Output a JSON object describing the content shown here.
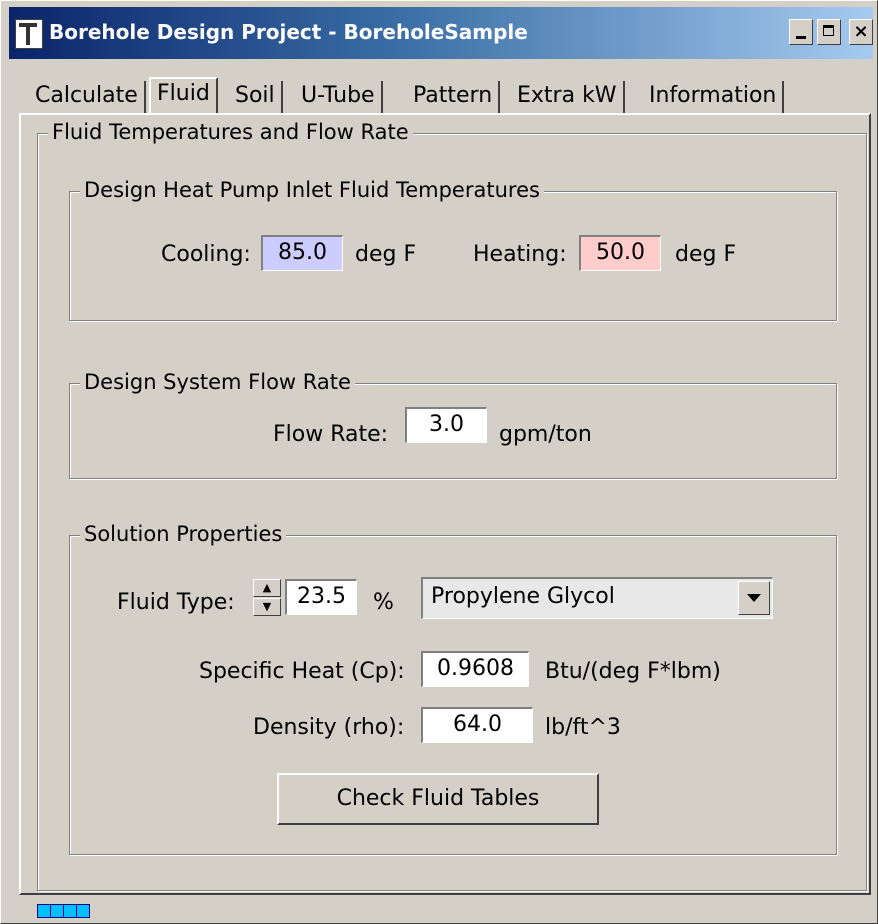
{
  "window": {
    "title": "Borehole Design Project - BoreholeSample"
  },
  "titlebar_buttons": {
    "minimize": "_",
    "maximize": "□",
    "close": "×"
  },
  "tabs": [
    {
      "label": "Calculate"
    },
    {
      "label": "Fluid",
      "active": true
    },
    {
      "label": "Soil"
    },
    {
      "label": "U-Tube"
    },
    {
      "label": "Pattern"
    },
    {
      "label": "Extra kW"
    },
    {
      "label": "Information"
    }
  ],
  "panel": {
    "title": "Fluid Temperatures and Flow Rate"
  },
  "temperatures": {
    "title": "Design Heat Pump Inlet Fluid Temperatures",
    "cooling_label": "Cooling:",
    "cooling_value": "85.0",
    "cooling_unit": "deg F",
    "heating_label": "Heating:",
    "heating_value": "50.0",
    "heating_unit": "deg F",
    "cooling_color": "#ccccff",
    "heating_color": "#ffcccc"
  },
  "flow": {
    "title": "Design System Flow Rate",
    "label": "Flow Rate:",
    "value": "3.0",
    "unit": "gpm/ton"
  },
  "solution": {
    "title": "Solution Properties",
    "fluid_type_label": "Fluid Type:",
    "concentration": "23.5",
    "concentration_unit": "%",
    "fluid_type": "Propylene Glycol",
    "cp_label": "Specific Heat (Cp):",
    "cp_value": "0.9608",
    "cp_unit": "Btu/(deg F*lbm)",
    "rho_label": "Density (rho):",
    "rho_value": "64.0",
    "rho_unit": "lb/ft^3",
    "check_button": "Check Fluid Tables"
  }
}
